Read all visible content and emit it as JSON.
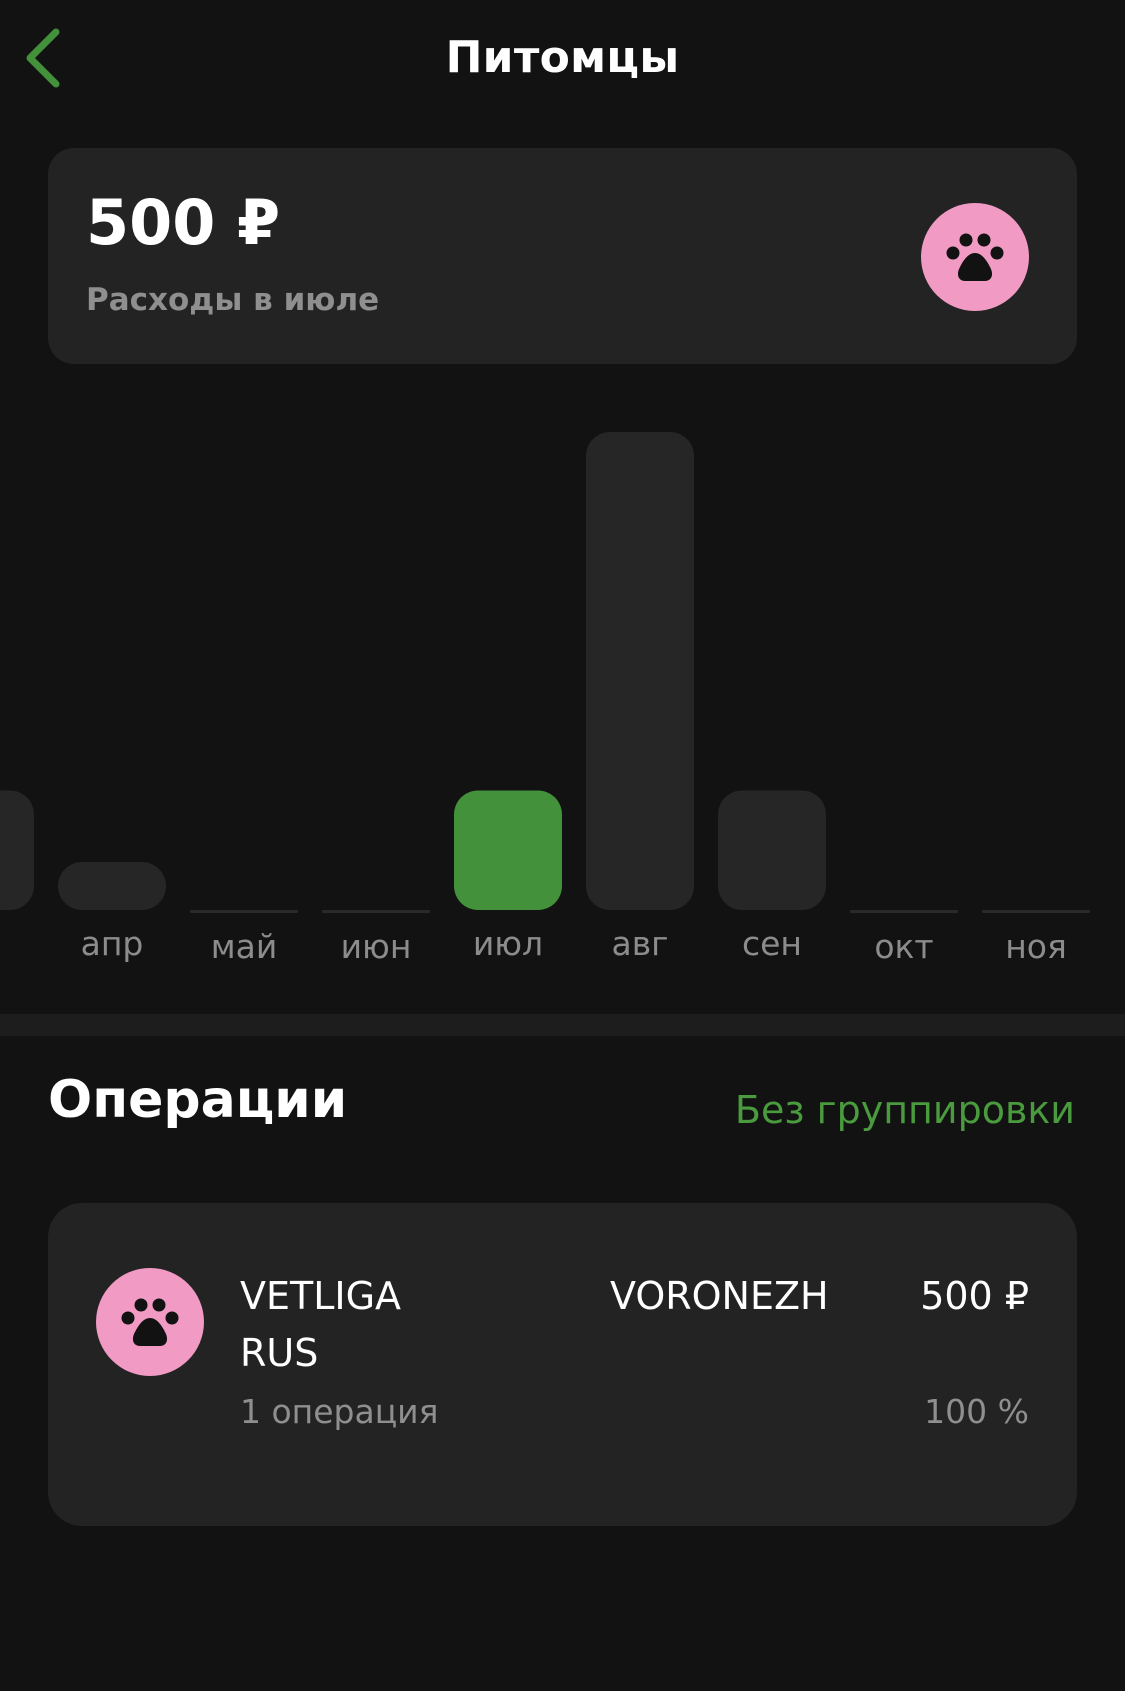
{
  "header": {
    "title": "Питомцы",
    "back_icon": "chevron-left-icon"
  },
  "colors": {
    "accent": "#43913a",
    "link": "#4a9a3e",
    "category_badge": "#f09ac4",
    "bar_inactive": "#262626",
    "card_bg": "#232323",
    "page_bg": "#121212"
  },
  "summary": {
    "amount": "500 ₽",
    "label": "Расходы в июле",
    "icon": "paw-icon"
  },
  "chart_data": {
    "type": "bar",
    "selected": "июл",
    "categories": [
      "мар",
      "апр",
      "май",
      "июн",
      "июл",
      "авг",
      "сен",
      "окт",
      "ноя"
    ],
    "visible_labels": [
      "р",
      "апр",
      "май",
      "июн",
      "июл",
      "авг",
      "сен",
      "окт",
      "ноя"
    ],
    "values": [
      500,
      100,
      0,
      0,
      500,
      2000,
      500,
      0,
      0
    ]
  },
  "operations": {
    "title": "Операции",
    "grouping_link": "Без группировки",
    "items": [
      {
        "icon": "paw-icon",
        "name_line1": "VETLIGA",
        "name_line2": "RUS",
        "city": "VORONEZH",
        "amount": "500 ₽",
        "count": "1 операция",
        "percent": "100 %"
      }
    ]
  }
}
